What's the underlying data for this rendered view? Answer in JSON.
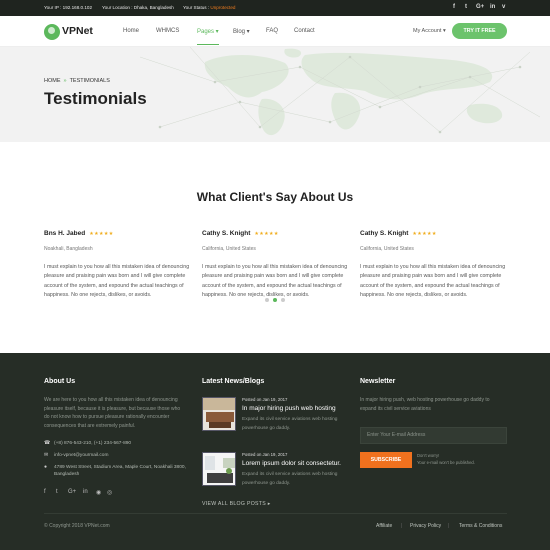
{
  "topbar": {
    "ip_label": "Your IP : 192.168.0.102",
    "location_label": "Your Location : Dhaka, Bangladesh",
    "status_prefix": "Your Status : ",
    "status_value": "Unprotected",
    "social": [
      "facebook-icon",
      "twitter-icon",
      "google-plus-icon",
      "linkedin-icon",
      "vimeo-icon"
    ]
  },
  "nav": {
    "brand": "VPNet",
    "items": [
      {
        "label": "Home"
      },
      {
        "label": "WHMCS"
      },
      {
        "label": "Pages ▾"
      },
      {
        "label": "Blog ▾"
      },
      {
        "label": "FAQ"
      },
      {
        "label": "Contact"
      }
    ],
    "active_index": 2,
    "account": "My Account ▾",
    "cta": "TRY IT FREE"
  },
  "hero": {
    "breadcrumb_home": "HOME",
    "breadcrumb_sep": "»",
    "breadcrumb_current": "TESTIMONIALS",
    "title": "Testimonials"
  },
  "testimonials": {
    "heading": "What Client's Say About Us",
    "items": [
      {
        "name": "Bns H. Jabed",
        "rating": 5,
        "stars": "★★★★★",
        "location": "Noakhali, Bangladesh",
        "lines": [
          "I must explain to you how all this mistaken idea of denouncing",
          "pleasure and praising pain was born and I will give complete",
          "account of the system, and expound the actual teachings of",
          "happiness. No one rejects, dislikes, or avoids."
        ]
      },
      {
        "name": "Cathy S. Knight",
        "rating": 5,
        "stars": "★★★★★",
        "location": "California, United States",
        "lines": [
          "I must explain to you how all this mistaken idea of denouncing",
          "pleasure and praising pain was born and I will give complete",
          "account of the system, and expound the actual teachings of",
          "happiness. No one rejects, dislikes, or avoids."
        ]
      },
      {
        "name": "Cathy S. Knight",
        "rating": 5,
        "stars": "★★★★★",
        "location": "California, United States",
        "lines": [
          "I must explain to you how all this mistaken idea of denouncing",
          "pleasure and praising pain was born and I will give complete",
          "account of the system, and expound the actual teachings of",
          "happiness. No one rejects, dislikes, or avoids."
        ]
      }
    ],
    "carousel_active": 1
  },
  "footer": {
    "about": {
      "heading": "About Us",
      "lines": [
        "We are here to you how all this mistaken idea of denouncing",
        "pleasure itself, because it is pleasure, but because those who",
        "do not know how to pursue pleasure rationally encounter",
        "consequences that are extremely painful."
      ],
      "phone": "(+8) 876-543-210, (+1) 234-567-890",
      "email": "info-vpnet@yourmail.com",
      "address_lines": [
        "4789 West Street, Stadium Area, Maple Court, Noakhali 3800,",
        "Bangladesh"
      ],
      "social": [
        "facebook-icon",
        "twitter-icon",
        "google-plus-icon",
        "linkedin-icon",
        "rss-icon",
        "instagram-icon"
      ]
    },
    "news": {
      "heading": "Latest News/Blogs",
      "posts": [
        {
          "date": "Posted on Jan 19, 2017",
          "title": "In major hiring push web hosting",
          "lines": [
            "Expand its civil service aviations web hosting",
            "powerhouse go daddy."
          ]
        },
        {
          "date": "Posted on Jan 19, 2017",
          "title": "Lorem ipsum dolor sit consectetur.",
          "lines": [
            "Expand its civil service aviations web hosting",
            "powerhouse go daddy."
          ]
        }
      ],
      "view_all": "VIEW ALL BLOG POSTS ▸"
    },
    "newsletter": {
      "heading": "Newsletter",
      "lines": [
        "In major hiring push, web hosting powerhouse go daddy to",
        "expand its civil service aviations"
      ],
      "placeholder": "Enter Your E-mail Address",
      "button": "SUBSCRIBE",
      "note_lines": [
        "Don't worry!",
        "Your e-mail won't be published."
      ]
    },
    "copyright": "© Copyright 2018 VPNet.com",
    "links": [
      "Affiliate",
      "Privacy Policy",
      "Terms & Conditions"
    ]
  },
  "colors": {
    "accent": "#5cb85c",
    "orange": "#f0711e",
    "topbar_bg": "#1f241f",
    "footer_bg": "#262d26"
  }
}
